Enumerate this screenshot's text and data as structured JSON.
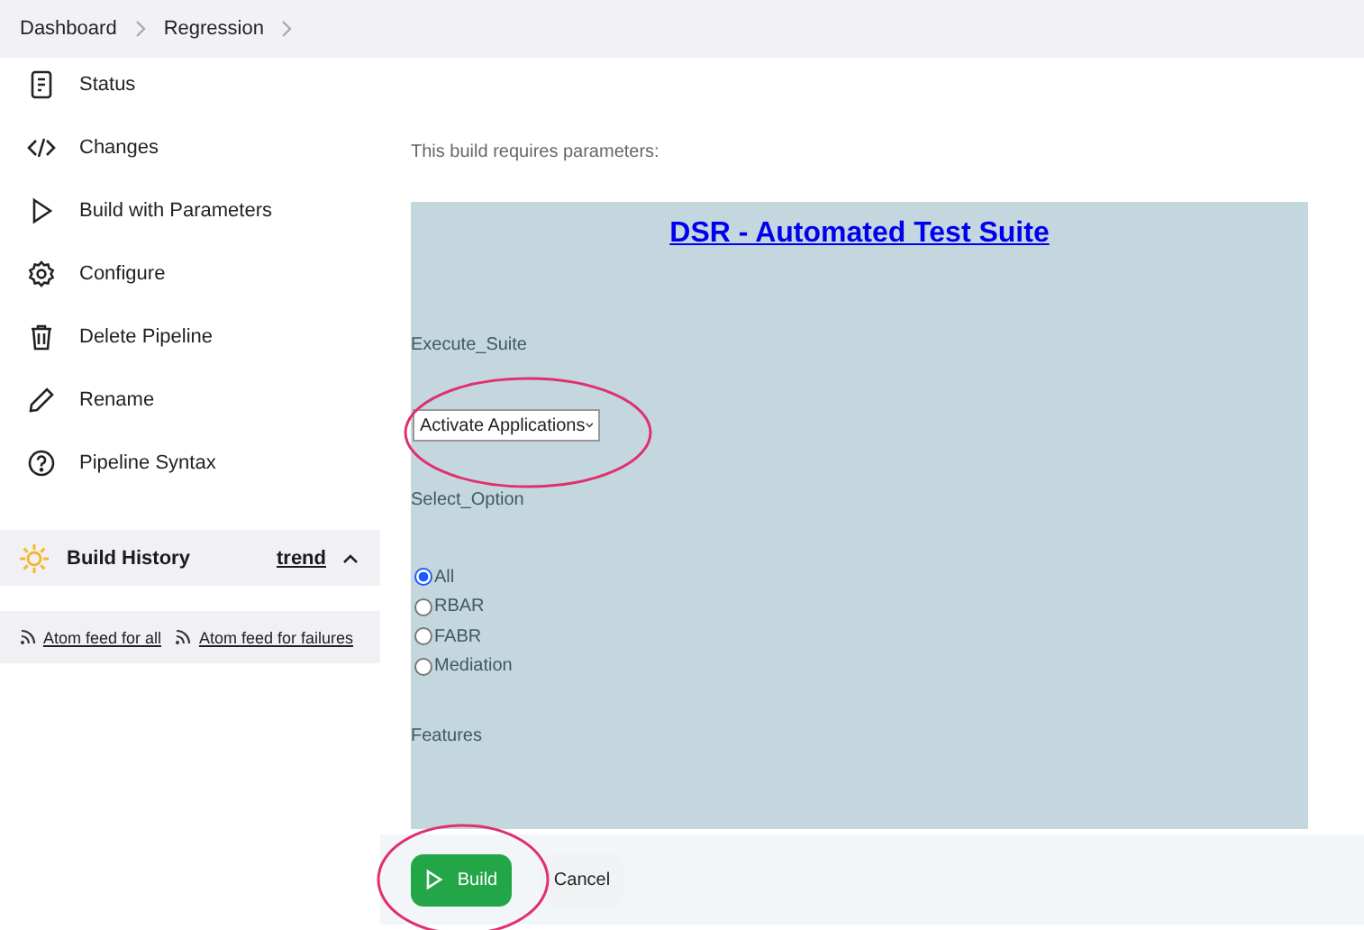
{
  "breadcrumb": [
    "Dashboard",
    "Regression"
  ],
  "sidebar": {
    "items": [
      {
        "label": "Status"
      },
      {
        "label": "Changes"
      },
      {
        "label": "Build with Parameters"
      },
      {
        "label": "Configure"
      },
      {
        "label": "Delete Pipeline"
      },
      {
        "label": "Rename"
      },
      {
        "label": "Pipeline Syntax"
      }
    ]
  },
  "build_history": {
    "title": "Build History",
    "trend": "trend",
    "expanded": true,
    "feeds": [
      "Atom feed for all",
      "Atom feed for failures"
    ]
  },
  "intro": "This build requires parameters:",
  "form": {
    "title": "DSR - Automated Test Suite",
    "execute_suite": {
      "label": "Execute_Suite",
      "value": "Activate Applications"
    },
    "select_option": {
      "label": "Select_Option",
      "options": [
        {
          "label": "All",
          "selected": true
        },
        {
          "label": "RBAR",
          "selected": false
        },
        {
          "label": "FABR",
          "selected": false
        },
        {
          "label": "Mediation",
          "selected": false
        }
      ]
    },
    "features": {
      "label": "Features"
    }
  },
  "buttons": {
    "build": "Build",
    "cancel": "Cancel"
  }
}
